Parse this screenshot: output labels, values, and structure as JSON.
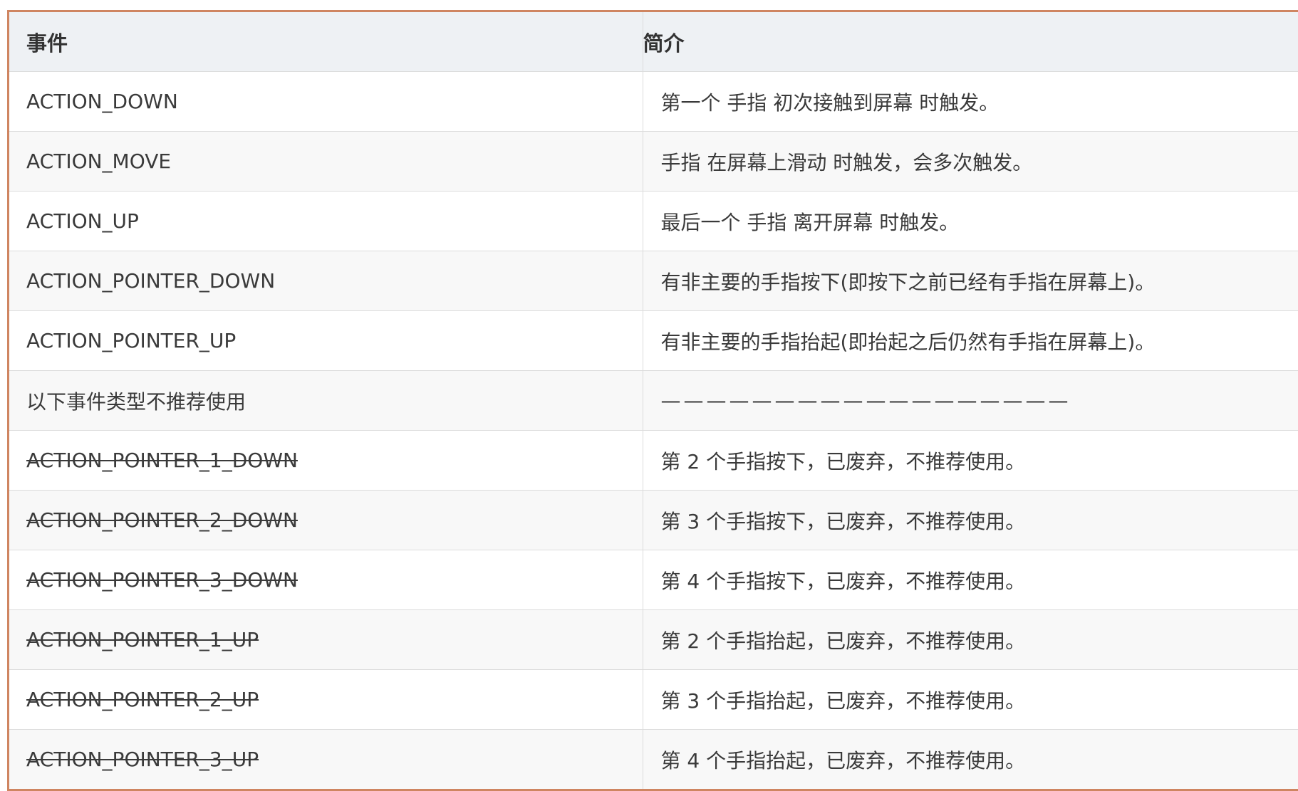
{
  "table": {
    "headers": [
      "事件",
      "简介"
    ],
    "rows": [
      {
        "event": "ACTION_DOWN",
        "desc": "第一个 手指 初次接触到屏幕 时触发。",
        "deprecated": false
      },
      {
        "event": "ACTION_MOVE",
        "desc": "手指 在屏幕上滑动 时触发，会多次触发。",
        "deprecated": false
      },
      {
        "event": "ACTION_UP",
        "desc": "最后一个 手指 离开屏幕 时触发。",
        "deprecated": false
      },
      {
        "event": "ACTION_POINTER_DOWN",
        "desc": "有非主要的手指按下(即按下之前已经有手指在屏幕上)。",
        "deprecated": false
      },
      {
        "event": "ACTION_POINTER_UP",
        "desc": "有非主要的手指抬起(即抬起之后仍然有手指在屏幕上)。",
        "deprecated": false
      },
      {
        "event": "以下事件类型不推荐使用",
        "desc": "——————————————————",
        "deprecated": false
      },
      {
        "event": "ACTION_POINTER_1_DOWN",
        "desc": "第 2 个手指按下，已废弃，不推荐使用。",
        "deprecated": true
      },
      {
        "event": "ACTION_POINTER_2_DOWN",
        "desc": "第 3 个手指按下，已废弃，不推荐使用。",
        "deprecated": true
      },
      {
        "event": "ACTION_POINTER_3_DOWN",
        "desc": "第 4 个手指按下，已废弃，不推荐使用。",
        "deprecated": true
      },
      {
        "event": "ACTION_POINTER_1_UP",
        "desc": "第 2 个手指抬起，已废弃，不推荐使用。",
        "deprecated": true
      },
      {
        "event": "ACTION_POINTER_2_UP",
        "desc": "第 3 个手指抬起，已废弃，不推荐使用。",
        "deprecated": true
      },
      {
        "event": "ACTION_POINTER_3_UP",
        "desc": "第 4 个手指抬起，已废弃，不推荐使用。",
        "deprecated": true
      }
    ]
  },
  "colors": {
    "frame_border": "#cf8561",
    "header_bg": "#eef1f4",
    "stripe_bg": "#f8f8f8",
    "grid_line": "#dcdcdc",
    "text": "#3a3a3a"
  }
}
